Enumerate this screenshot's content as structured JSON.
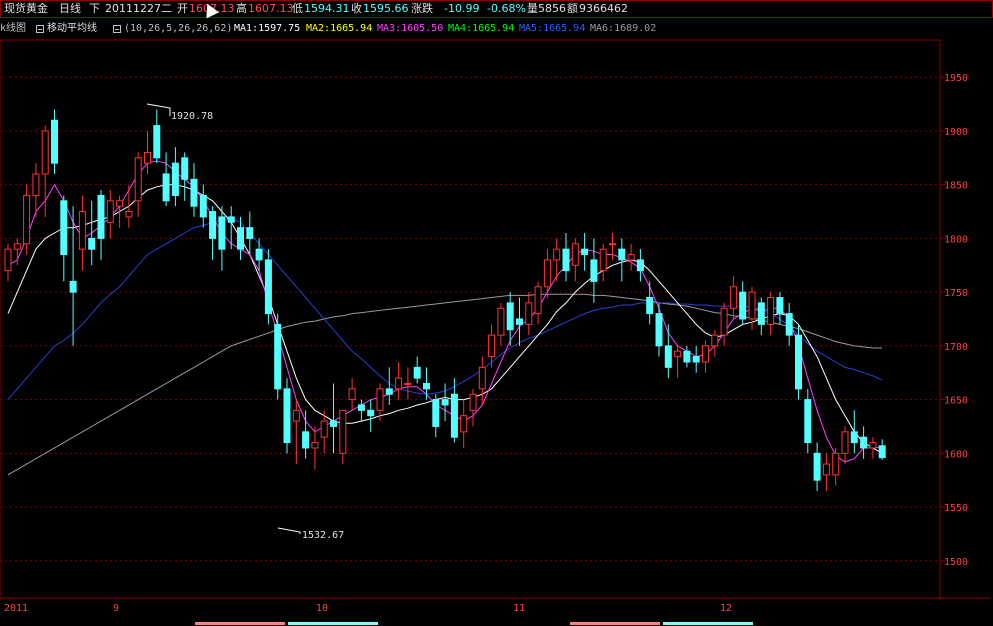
{
  "header": {
    "instrument": "现货黄金",
    "period": "日线",
    "direction": "下",
    "date": "20111227",
    "weekday": "二",
    "open_label": "开",
    "open_value": "1607.13",
    "high_label": "高",
    "high_value": "1607.13",
    "low_label": "低",
    "low_value": "1594.31",
    "close_label": "收",
    "close_value": "1595.66",
    "change_label": "涨跌",
    "change_value": "-10.99",
    "change_pct": "-0.68%",
    "volume_label": "量",
    "volume_value": "5856",
    "amount_label": "额",
    "amount_value": "9366462"
  },
  "indicator": {
    "left_label": "k线图",
    "name": "移动平均线",
    "params": "(10,26,5,26,26,62)",
    "ma1": "MA1:1597.75",
    "ma2": "MA2:1665.94",
    "ma3": "MA3:1605.50",
    "ma4": "MA4:1665.94",
    "ma5": "MA5:1665.94",
    "ma6": "MA6:1689.02"
  },
  "annotations": {
    "high_label": "1920.78",
    "low_label": "1532.67"
  },
  "colors": {
    "bg": "#000000",
    "up": "#ff3232",
    "down": "#54ffff",
    "grid": "#800000",
    "axis_text": "#ff4040",
    "ma1": "#ffffff",
    "ma3": "#ff40ff",
    "ma5": "#2a3fd0",
    "ma6": "#9a9a9a",
    "ma2": "#ffff00",
    "ma4": "#00ff00"
  },
  "chart_data": {
    "type": "candlestick",
    "ylim": [
      1470,
      1980
    ],
    "y_ticks": [
      "1950",
      "1900",
      "1850",
      "1800",
      "1750",
      "1700",
      "1650",
      "1600",
      "1550",
      "1500"
    ],
    "x_labels": [
      "2011",
      "9",
      "10",
      "11",
      "12"
    ],
    "candles": [
      [
        1770,
        1795,
        1760,
        1790
      ],
      [
        1790,
        1800,
        1775,
        1795
      ],
      [
        1795,
        1850,
        1785,
        1840
      ],
      [
        1840,
        1870,
        1820,
        1860
      ],
      [
        1860,
        1905,
        1820,
        1900
      ],
      [
        1910,
        1920,
        1860,
        1870
      ],
      [
        1835,
        1840,
        1760,
        1785
      ],
      [
        1760,
        1830,
        1700,
        1750
      ],
      [
        1790,
        1840,
        1770,
        1825
      ],
      [
        1800,
        1835,
        1775,
        1790
      ],
      [
        1840,
        1845,
        1780,
        1800
      ],
      [
        1815,
        1845,
        1800,
        1835
      ],
      [
        1830,
        1840,
        1810,
        1835
      ],
      [
        1820,
        1850,
        1810,
        1825
      ],
      [
        1835,
        1880,
        1820,
        1875
      ],
      [
        1870,
        1900,
        1860,
        1880
      ],
      [
        1905,
        1920,
        1870,
        1875
      ],
      [
        1860,
        1880,
        1830,
        1835
      ],
      [
        1870,
        1885,
        1830,
        1840
      ],
      [
        1875,
        1880,
        1835,
        1855
      ],
      [
        1855,
        1870,
        1820,
        1830
      ],
      [
        1840,
        1850,
        1810,
        1820
      ],
      [
        1825,
        1830,
        1780,
        1800
      ],
      [
        1820,
        1830,
        1770,
        1790
      ],
      [
        1820,
        1830,
        1790,
        1815
      ],
      [
        1810,
        1820,
        1780,
        1790
      ],
      [
        1810,
        1825,
        1785,
        1800
      ],
      [
        1790,
        1800,
        1770,
        1780
      ],
      [
        1780,
        1790,
        1720,
        1730
      ],
      [
        1720,
        1730,
        1650,
        1660
      ],
      [
        1660,
        1670,
        1600,
        1610
      ],
      [
        1630,
        1650,
        1590,
        1640
      ],
      [
        1620,
        1640,
        1595,
        1605
      ],
      [
        1605,
        1625,
        1585,
        1610
      ],
      [
        1615,
        1640,
        1600,
        1630
      ],
      [
        1630,
        1665,
        1600,
        1625
      ],
      [
        1600,
        1635,
        1590,
        1640
      ],
      [
        1650,
        1670,
        1640,
        1660
      ],
      [
        1645,
        1650,
        1630,
        1640
      ],
      [
        1640,
        1650,
        1620,
        1635
      ],
      [
        1640,
        1665,
        1630,
        1660
      ],
      [
        1660,
        1680,
        1645,
        1655
      ],
      [
        1660,
        1685,
        1650,
        1670
      ],
      [
        1665,
        1680,
        1650,
        1665
      ],
      [
        1680,
        1690,
        1665,
        1670
      ],
      [
        1665,
        1680,
        1650,
        1660
      ],
      [
        1650,
        1655,
        1615,
        1625
      ],
      [
        1650,
        1665,
        1630,
        1645
      ],
      [
        1655,
        1670,
        1610,
        1615
      ],
      [
        1620,
        1650,
        1605,
        1635
      ],
      [
        1640,
        1660,
        1625,
        1655
      ],
      [
        1660,
        1690,
        1645,
        1680
      ],
      [
        1690,
        1720,
        1680,
        1710
      ],
      [
        1710,
        1740,
        1700,
        1735
      ],
      [
        1740,
        1750,
        1700,
        1715
      ],
      [
        1725,
        1745,
        1700,
        1720
      ],
      [
        1720,
        1750,
        1710,
        1740
      ],
      [
        1730,
        1760,
        1720,
        1755
      ],
      [
        1755,
        1790,
        1745,
        1780
      ],
      [
        1780,
        1800,
        1760,
        1790
      ],
      [
        1790,
        1805,
        1760,
        1770
      ],
      [
        1775,
        1800,
        1760,
        1795
      ],
      [
        1790,
        1805,
        1770,
        1785
      ],
      [
        1780,
        1800,
        1740,
        1760
      ],
      [
        1770,
        1795,
        1760,
        1790
      ],
      [
        1795,
        1805,
        1780,
        1795
      ],
      [
        1790,
        1800,
        1760,
        1780
      ],
      [
        1780,
        1795,
        1770,
        1785
      ],
      [
        1780,
        1790,
        1760,
        1770
      ],
      [
        1745,
        1760,
        1720,
        1730
      ],
      [
        1730,
        1740,
        1690,
        1700
      ],
      [
        1700,
        1720,
        1670,
        1680
      ],
      [
        1690,
        1700,
        1670,
        1695
      ],
      [
        1695,
        1700,
        1680,
        1685
      ],
      [
        1690,
        1700,
        1675,
        1685
      ],
      [
        1685,
        1705,
        1675,
        1700
      ],
      [
        1700,
        1715,
        1690,
        1710
      ],
      [
        1710,
        1740,
        1700,
        1735
      ],
      [
        1735,
        1765,
        1725,
        1755
      ],
      [
        1750,
        1760,
        1720,
        1725
      ],
      [
        1725,
        1755,
        1715,
        1750
      ],
      [
        1740,
        1745,
        1710,
        1720
      ],
      [
        1720,
        1750,
        1710,
        1745
      ],
      [
        1745,
        1750,
        1720,
        1730
      ],
      [
        1730,
        1740,
        1700,
        1710
      ],
      [
        1710,
        1720,
        1650,
        1660
      ],
      [
        1650,
        1660,
        1600,
        1610
      ],
      [
        1600,
        1610,
        1565,
        1575
      ],
      [
        1580,
        1600,
        1565,
        1590
      ],
      [
        1580,
        1605,
        1570,
        1600
      ],
      [
        1600,
        1625,
        1590,
        1620
      ],
      [
        1620,
        1640,
        1600,
        1610
      ],
      [
        1615,
        1625,
        1595,
        1605
      ],
      [
        1605,
        1615,
        1595,
        1610
      ],
      [
        1607,
        1613,
        1594,
        1596
      ]
    ],
    "ma1": [
      1730,
      1750,
      1770,
      1790,
      1800,
      1805,
      1810,
      1810,
      1812,
      1815,
      1818,
      1820,
      1825,
      1830,
      1838,
      1845,
      1848,
      1850,
      1850,
      1848,
      1845,
      1840,
      1835,
      1825,
      1815,
      1800,
      1785,
      1765,
      1745,
      1720,
      1695,
      1670,
      1650,
      1640,
      1635,
      1630,
      1628,
      1628,
      1630,
      1632,
      1635,
      1637,
      1640,
      1642,
      1645,
      1647,
      1650,
      1652,
      1650,
      1650,
      1652,
      1655,
      1660,
      1670,
      1680,
      1690,
      1700,
      1710,
      1720,
      1732,
      1740,
      1750,
      1758,
      1765,
      1770,
      1775,
      1778,
      1780,
      1778,
      1770,
      1760,
      1750,
      1740,
      1730,
      1720,
      1712,
      1708,
      1710,
      1715,
      1720,
      1722,
      1725,
      1728,
      1730,
      1728,
      1720,
      1705,
      1690,
      1670,
      1650,
      1635,
      1620,
      1610,
      1605,
      1600
    ],
    "ma3": [
      1775,
      1780,
      1800,
      1825,
      1835,
      1850,
      1835,
      1815,
      1800,
      1805,
      1812,
      1820,
      1830,
      1845,
      1860,
      1870,
      1872,
      1870,
      1862,
      1855,
      1848,
      1835,
      1820,
      1805,
      1795,
      1790,
      1785,
      1770,
      1740,
      1710,
      1680,
      1650,
      1630,
      1620,
      1625,
      1630,
      1635,
      1640,
      1645,
      1650,
      1652,
      1655,
      1660,
      1662,
      1662,
      1655,
      1645,
      1640,
      1635,
      1630,
      1635,
      1645,
      1665,
      1685,
      1705,
      1718,
      1725,
      1735,
      1750,
      1765,
      1775,
      1785,
      1790,
      1788,
      1785,
      1785,
      1782,
      1778,
      1772,
      1755,
      1735,
      1712,
      1700,
      1695,
      1690,
      1692,
      1700,
      1712,
      1725,
      1730,
      1735,
      1732,
      1735,
      1735,
      1725,
      1700,
      1670,
      1640,
      1615,
      1598,
      1592,
      1595,
      1605,
      1605,
      1606
    ],
    "ma5": [
      1650,
      1660,
      1670,
      1680,
      1690,
      1700,
      1705,
      1712,
      1720,
      1730,
      1740,
      1748,
      1755,
      1765,
      1775,
      1785,
      1790,
      1795,
      1800,
      1805,
      1810,
      1812,
      1815,
      1817,
      1818,
      1815,
      1805,
      1795,
      1785,
      1775,
      1765,
      1755,
      1745,
      1735,
      1725,
      1715,
      1705,
      1695,
      1688,
      1680,
      1672,
      1665,
      1660,
      1658,
      1656,
      1655,
      1656,
      1658,
      1662,
      1667,
      1672,
      1678,
      1685,
      1692,
      1698,
      1703,
      1707,
      1710,
      1714,
      1718,
      1722,
      1726,
      1730,
      1733,
      1735,
      1736,
      1738,
      1738,
      1740,
      1740,
      1740,
      1740,
      1739,
      1739,
      1738,
      1738,
      1737,
      1737,
      1737,
      1737,
      1736,
      1734,
      1730,
      1725,
      1718,
      1710,
      1702,
      1695,
      1690,
      1685,
      1680,
      1678,
      1675,
      1672,
      1668
    ],
    "ma6": [
      1580,
      1585,
      1590,
      1595,
      1600,
      1605,
      1610,
      1615,
      1620,
      1625,
      1630,
      1635,
      1640,
      1645,
      1650,
      1655,
      1660,
      1665,
      1670,
      1675,
      1680,
      1685,
      1690,
      1695,
      1700,
      1703,
      1706,
      1709,
      1712,
      1715,
      1718,
      1720,
      1722,
      1723,
      1725,
      1727,
      1728,
      1730,
      1731,
      1732,
      1733,
      1734,
      1735,
      1736,
      1737,
      1738,
      1739,
      1740,
      1741,
      1742,
      1743,
      1744,
      1745,
      1746,
      1747,
      1747,
      1747,
      1748,
      1748,
      1748,
      1748,
      1748,
      1748,
      1747,
      1747,
      1746,
      1745,
      1744,
      1743,
      1742,
      1740,
      1739,
      1738,
      1737,
      1735,
      1733,
      1731,
      1730,
      1728,
      1727,
      1726,
      1724,
      1722,
      1720,
      1718,
      1716,
      1713,
      1710,
      1707,
      1704,
      1702,
      1700,
      1699,
      1698,
      1698
    ]
  }
}
